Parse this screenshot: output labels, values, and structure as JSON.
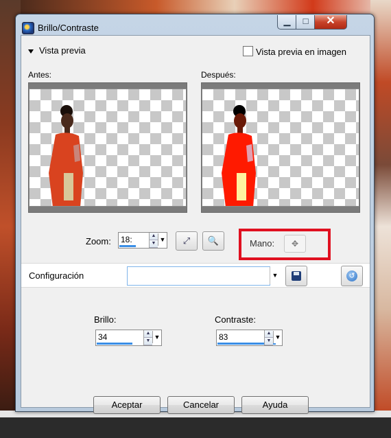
{
  "window": {
    "title": "Brillo/Contraste"
  },
  "preview": {
    "toggle_label": "Vista previa",
    "image_preview_label": "Vista previa en imagen",
    "before_label": "Antes:",
    "after_label": "Después:"
  },
  "zoom": {
    "label": "Zoom:",
    "value": "18:"
  },
  "mano": {
    "label": "Mano:"
  },
  "config": {
    "label": "Configuración",
    "value": ""
  },
  "brillo": {
    "label": "Brillo:",
    "value": "34",
    "level": 0.34
  },
  "contraste": {
    "label": "Contraste:",
    "value": "83",
    "level": 0.83
  },
  "buttons": {
    "ok": "Aceptar",
    "cancel": "Cancelar",
    "help": "Ayuda"
  },
  "colors": {
    "accent": "#3a8ee6",
    "highlight_box": "#e01020",
    "dress_before": "#d9431f",
    "dress_after": "#ff1a00"
  },
  "icons": [
    "app-icon",
    "minimize-icon",
    "maximize-icon",
    "close-icon",
    "fit-window-icon",
    "zoom-icon",
    "hand-icon",
    "save-icon",
    "reset-icon"
  ]
}
